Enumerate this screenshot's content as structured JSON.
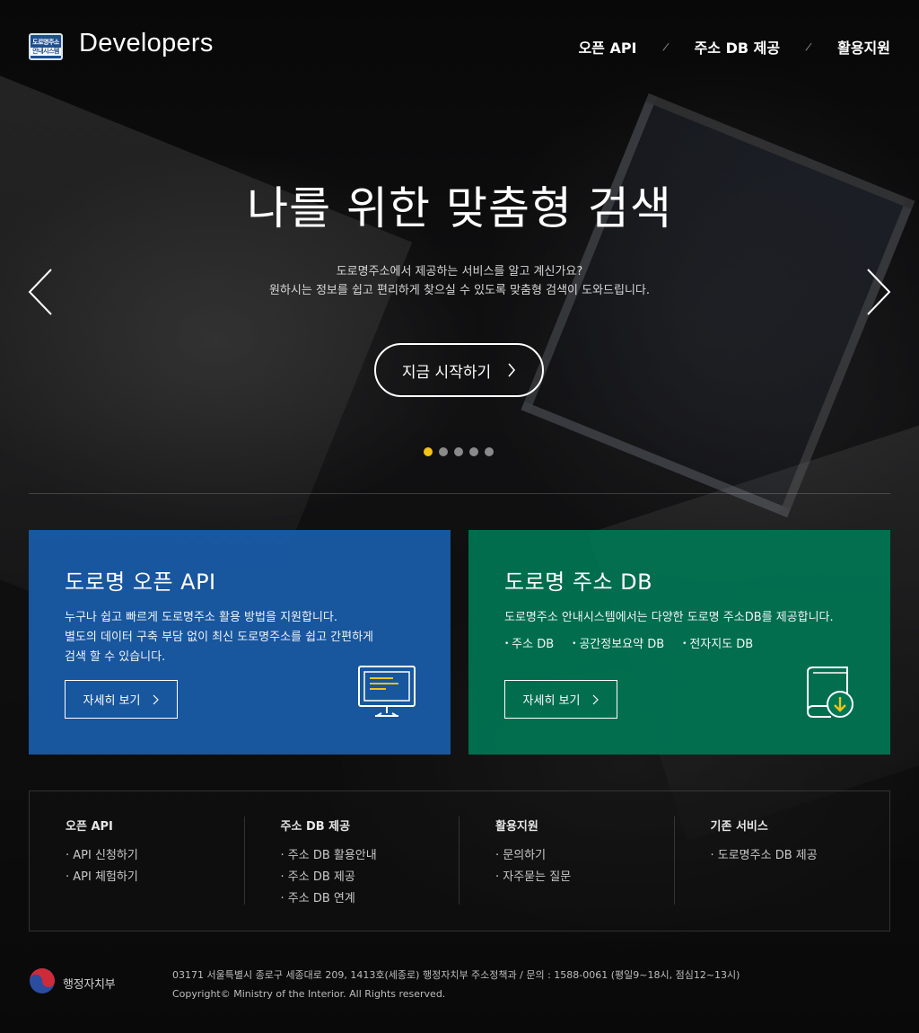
{
  "header": {
    "badge_top": "도로명주소",
    "badge_bottom": "안내시스템",
    "brand": "Developers",
    "nav": [
      {
        "label": "오픈 API"
      },
      {
        "label": "주소 DB 제공"
      },
      {
        "label": "활용지원"
      }
    ],
    "separator": "/"
  },
  "hero": {
    "title": "나를 위한 맞춤형 검색",
    "desc_line1": "도로명주소에서 제공하는 서비스를 알고 계신가요?",
    "desc_line2": "원하시는 정보를 쉽고 편리하게 찾으실 수 있도록 맞춤형 검색이 도와드립니다.",
    "cta_label": "지금 시작하기",
    "slide_count": 5,
    "active_slide": 1,
    "active_dot_color": "#f2c316"
  },
  "cards": {
    "api": {
      "title": "도로명 오픈 API",
      "line1": "누구나 쉽고 빠르게 도로명주소 활용 방법을 지원합니다.",
      "line2": "별도의 데이터 구축 부담 없이 최신 도로명주소를 쉽고 간편하게",
      "line3": "검색 할 수 있습니다.",
      "button": "자세히 보기",
      "color": "#195caa"
    },
    "db": {
      "title": "도로명 주소 DB",
      "line1": "도로명주소 안내시스템에서는 다양한 도로명 주소DB를 제공합니다.",
      "items": [
        "주소 DB",
        "공간정보요약 DB",
        "전자지도 DB"
      ],
      "button": "자세히 보기",
      "color": "#007854"
    }
  },
  "sitemap": [
    {
      "title": "오픈 API",
      "links": [
        "API  신청하기",
        "API  체험하기"
      ]
    },
    {
      "title": "주소 DB 제공",
      "links": [
        "주소 DB 활용안내",
        "주소 DB 제공",
        "주소 DB 연계"
      ]
    },
    {
      "title": "활용지원",
      "links": [
        "문의하기",
        "자주묻는 질문"
      ]
    },
    {
      "title": "기존 서비스",
      "links": [
        "도로명주소 DB 제공"
      ]
    }
  ],
  "footer": {
    "org": "행정자치부",
    "address": "03171 서울특별시 종로구 세종대로 209, 1413호(세종로) 행정자치부 주소정책과 / 문의 : 1588-0061 (평일9~18시, 점심12~13시)",
    "copyright": "Copyright© Ministry of the Interior. All Rights reserved."
  }
}
